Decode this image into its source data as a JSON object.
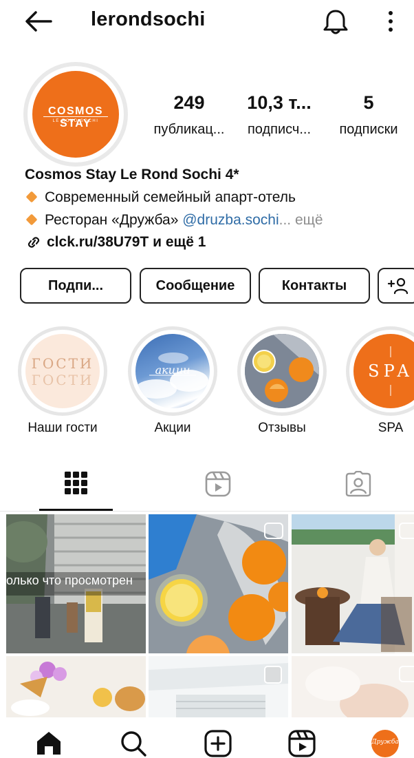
{
  "header": {
    "username": "lerondsochi",
    "back_icon": "arrow-left-icon",
    "bell_icon": "bell-icon",
    "more_icon": "more-vertical-icon"
  },
  "avatar": {
    "brand": "COSMOS STAY",
    "sub": "LE ROND SOCHI",
    "color": "#ee6f1a"
  },
  "stats": [
    {
      "value": "249",
      "label": "публикац..."
    },
    {
      "value": "10,3 т...",
      "label": "подписч..."
    },
    {
      "value": "5",
      "label": "подписки"
    }
  ],
  "bio": {
    "name": "Cosmos Stay Le Rond Sochi 4*",
    "line1": "Современный семейный апарт-отель",
    "line2_prefix": "Ресторан «Дружба» ",
    "line2_mention": "@druzba.sochi",
    "line2_more": "... ещё",
    "link": "clck.ru/38U79T и ещё 1",
    "accent": "#2f6ca6"
  },
  "buttons": {
    "follow": "Подпи...",
    "message": "Сообщение",
    "contacts": "Контакты",
    "add_user_icon": "add-user-icon"
  },
  "highlights": [
    {
      "label": "Наши гости",
      "text": "гости\nгости"
    },
    {
      "label": "Акции",
      "text": "акции"
    },
    {
      "label": "Отзывы"
    },
    {
      "label": "SPA",
      "text": "SPA"
    }
  ],
  "tabs": {
    "grid_icon": "grid-icon",
    "reels_icon": "reels-icon",
    "tagged_icon": "tagged-icon"
  },
  "grid": {
    "overlay_text": "олько что просмотрен"
  },
  "bottom_nav": {
    "home_icon": "home-icon",
    "search_icon": "search-icon",
    "create_icon": "create-icon",
    "reels_icon": "reels-icon",
    "profile_text": "Дружба"
  }
}
